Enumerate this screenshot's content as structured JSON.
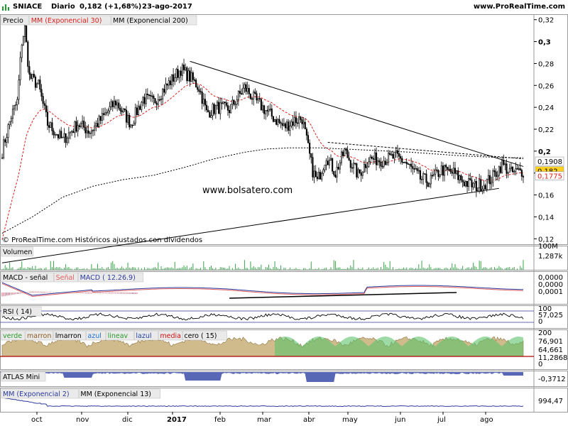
{
  "header": {
    "symbol": "SNIACE",
    "period": "Diario",
    "price": "0,182 (+1,68%)",
    "date": "23-ago-2017",
    "site": "www.ProRealTime.com"
  },
  "watermark": "www.bolsatero.com",
  "footer_note": "© ProRealTime.com  Históricos ajustados con dividendos",
  "colors": {
    "bull": "#ffffff",
    "bear": "#000000",
    "ema30": "#e0201b",
    "ema200": "#000000",
    "panel_bg": "#ffffff",
    "legend_bg": "#eaeaea",
    "last_price_box": "#ffd21f",
    "rsi_line": "#000000",
    "macd_line": "#2b3a9c",
    "signal_line": "#e06060"
  },
  "chart_data": [
    {
      "type": "candlestick",
      "panel": "price",
      "legend": [
        "Precio",
        "MM (Exponencial 30)",
        "MM (Exponencial 200)"
      ],
      "ylim": [
        0.115,
        0.325
      ],
      "y_ticks": [
        "0,32",
        "0,3",
        "0,28",
        "0,26",
        "0,24",
        "0,22",
        "0,2",
        "0,18",
        "0,16",
        "0,14",
        "0,12"
      ],
      "x_ticks": [
        "oct",
        "nov",
        "dic",
        "2017",
        "feb",
        "mar",
        "abr",
        "may",
        "jun",
        "jul",
        "ago"
      ],
      "price_labels": [
        "0,1908",
        "0,182",
        "0,1775"
      ],
      "price_anchors": [
        [
          0,
          0.2
        ],
        [
          6,
          0.232
        ],
        [
          10,
          0.245
        ],
        [
          13,
          0.3
        ],
        [
          15,
          0.312
        ],
        [
          18,
          0.268
        ],
        [
          24,
          0.26
        ],
        [
          30,
          0.225
        ],
        [
          40,
          0.21
        ],
        [
          50,
          0.225
        ],
        [
          58,
          0.218
        ],
        [
          66,
          0.23
        ],
        [
          75,
          0.245
        ],
        [
          85,
          0.225
        ],
        [
          93,
          0.248
        ],
        [
          100,
          0.245
        ],
        [
          110,
          0.262
        ],
        [
          118,
          0.275
        ],
        [
          125,
          0.266
        ],
        [
          130,
          0.258
        ],
        [
          135,
          0.235
        ],
        [
          142,
          0.24
        ],
        [
          150,
          0.238
        ],
        [
          160,
          0.258
        ],
        [
          168,
          0.245
        ],
        [
          178,
          0.232
        ],
        [
          186,
          0.222
        ],
        [
          193,
          0.228
        ],
        [
          198,
          0.23
        ],
        [
          205,
          0.182
        ],
        [
          208,
          0.172
        ],
        [
          214,
          0.196
        ],
        [
          220,
          0.18
        ],
        [
          226,
          0.2
        ],
        [
          235,
          0.178
        ],
        [
          242,
          0.193
        ],
        [
          252,
          0.192
        ],
        [
          260,
          0.195
        ],
        [
          266,
          0.19
        ],
        [
          270,
          0.184
        ],
        [
          276,
          0.175
        ],
        [
          282,
          0.172
        ],
        [
          290,
          0.183
        ],
        [
          298,
          0.18
        ],
        [
          305,
          0.172
        ],
        [
          312,
          0.168
        ],
        [
          318,
          0.17
        ],
        [
          323,
          0.175
        ],
        [
          330,
          0.188
        ],
        [
          336,
          0.18
        ],
        [
          344,
          0.182
        ]
      ],
      "ema200_anchors": [
        [
          0,
          0.125
        ],
        [
          20,
          0.14
        ],
        [
          40,
          0.158
        ],
        [
          60,
          0.168
        ],
        [
          80,
          0.174
        ],
        [
          100,
          0.178
        ],
        [
          120,
          0.185
        ],
        [
          140,
          0.193
        ],
        [
          160,
          0.199
        ],
        [
          175,
          0.202
        ],
        [
          190,
          0.203
        ],
        [
          210,
          0.203
        ],
        [
          240,
          0.201
        ],
        [
          270,
          0.199
        ],
        [
          300,
          0.196
        ],
        [
          330,
          0.194
        ],
        [
          344,
          0.194
        ]
      ],
      "trendlines": [
        {
          "from": [
            124,
            0.282
          ],
          "to": [
            344,
            0.186
          ],
          "style": "solid"
        },
        {
          "from": [
            0,
            0.098
          ],
          "to": [
            328,
            0.166
          ],
          "style": "solid"
        },
        {
          "from": [
            215,
            0.208
          ],
          "to": [
            344,
            0.193
          ],
          "style": "dashed"
        }
      ]
    },
    {
      "type": "bar",
      "panel": "volume",
      "legend": [
        "Volumen"
      ],
      "labels": [
        "100M",
        "1,287k"
      ]
    },
    {
      "type": "line",
      "panel": "macd",
      "legend": [
        "MACD - señal",
        "Señal",
        "MACD ( 12.26.9)"
      ],
      "labels": [
        "0,0000",
        "0,0000",
        "0,0001"
      ]
    },
    {
      "type": "line",
      "panel": "rsi",
      "legend": [
        "RSI ( 14)"
      ],
      "labels": [
        "100",
        "57,025",
        "0"
      ]
    },
    {
      "type": "area",
      "panel": "oscillator",
      "legend": [
        "verde",
        "marron",
        "lmarron",
        "azul",
        "lineav",
        "lazul",
        "media",
        "cero ( 15)"
      ],
      "labels": [
        "200",
        "76,901",
        "64,661",
        "11,2868",
        "0"
      ]
    },
    {
      "type": "area",
      "panel": "atlas",
      "legend": [
        "ATLAS Mini"
      ],
      "labels": [
        "-0,3712"
      ]
    },
    {
      "type": "line",
      "panel": "ema_mini",
      "legend": [
        "MM (Exponencial 2)",
        "MM (Exponencial 13)"
      ],
      "labels": [
        "994,47"
      ]
    }
  ]
}
